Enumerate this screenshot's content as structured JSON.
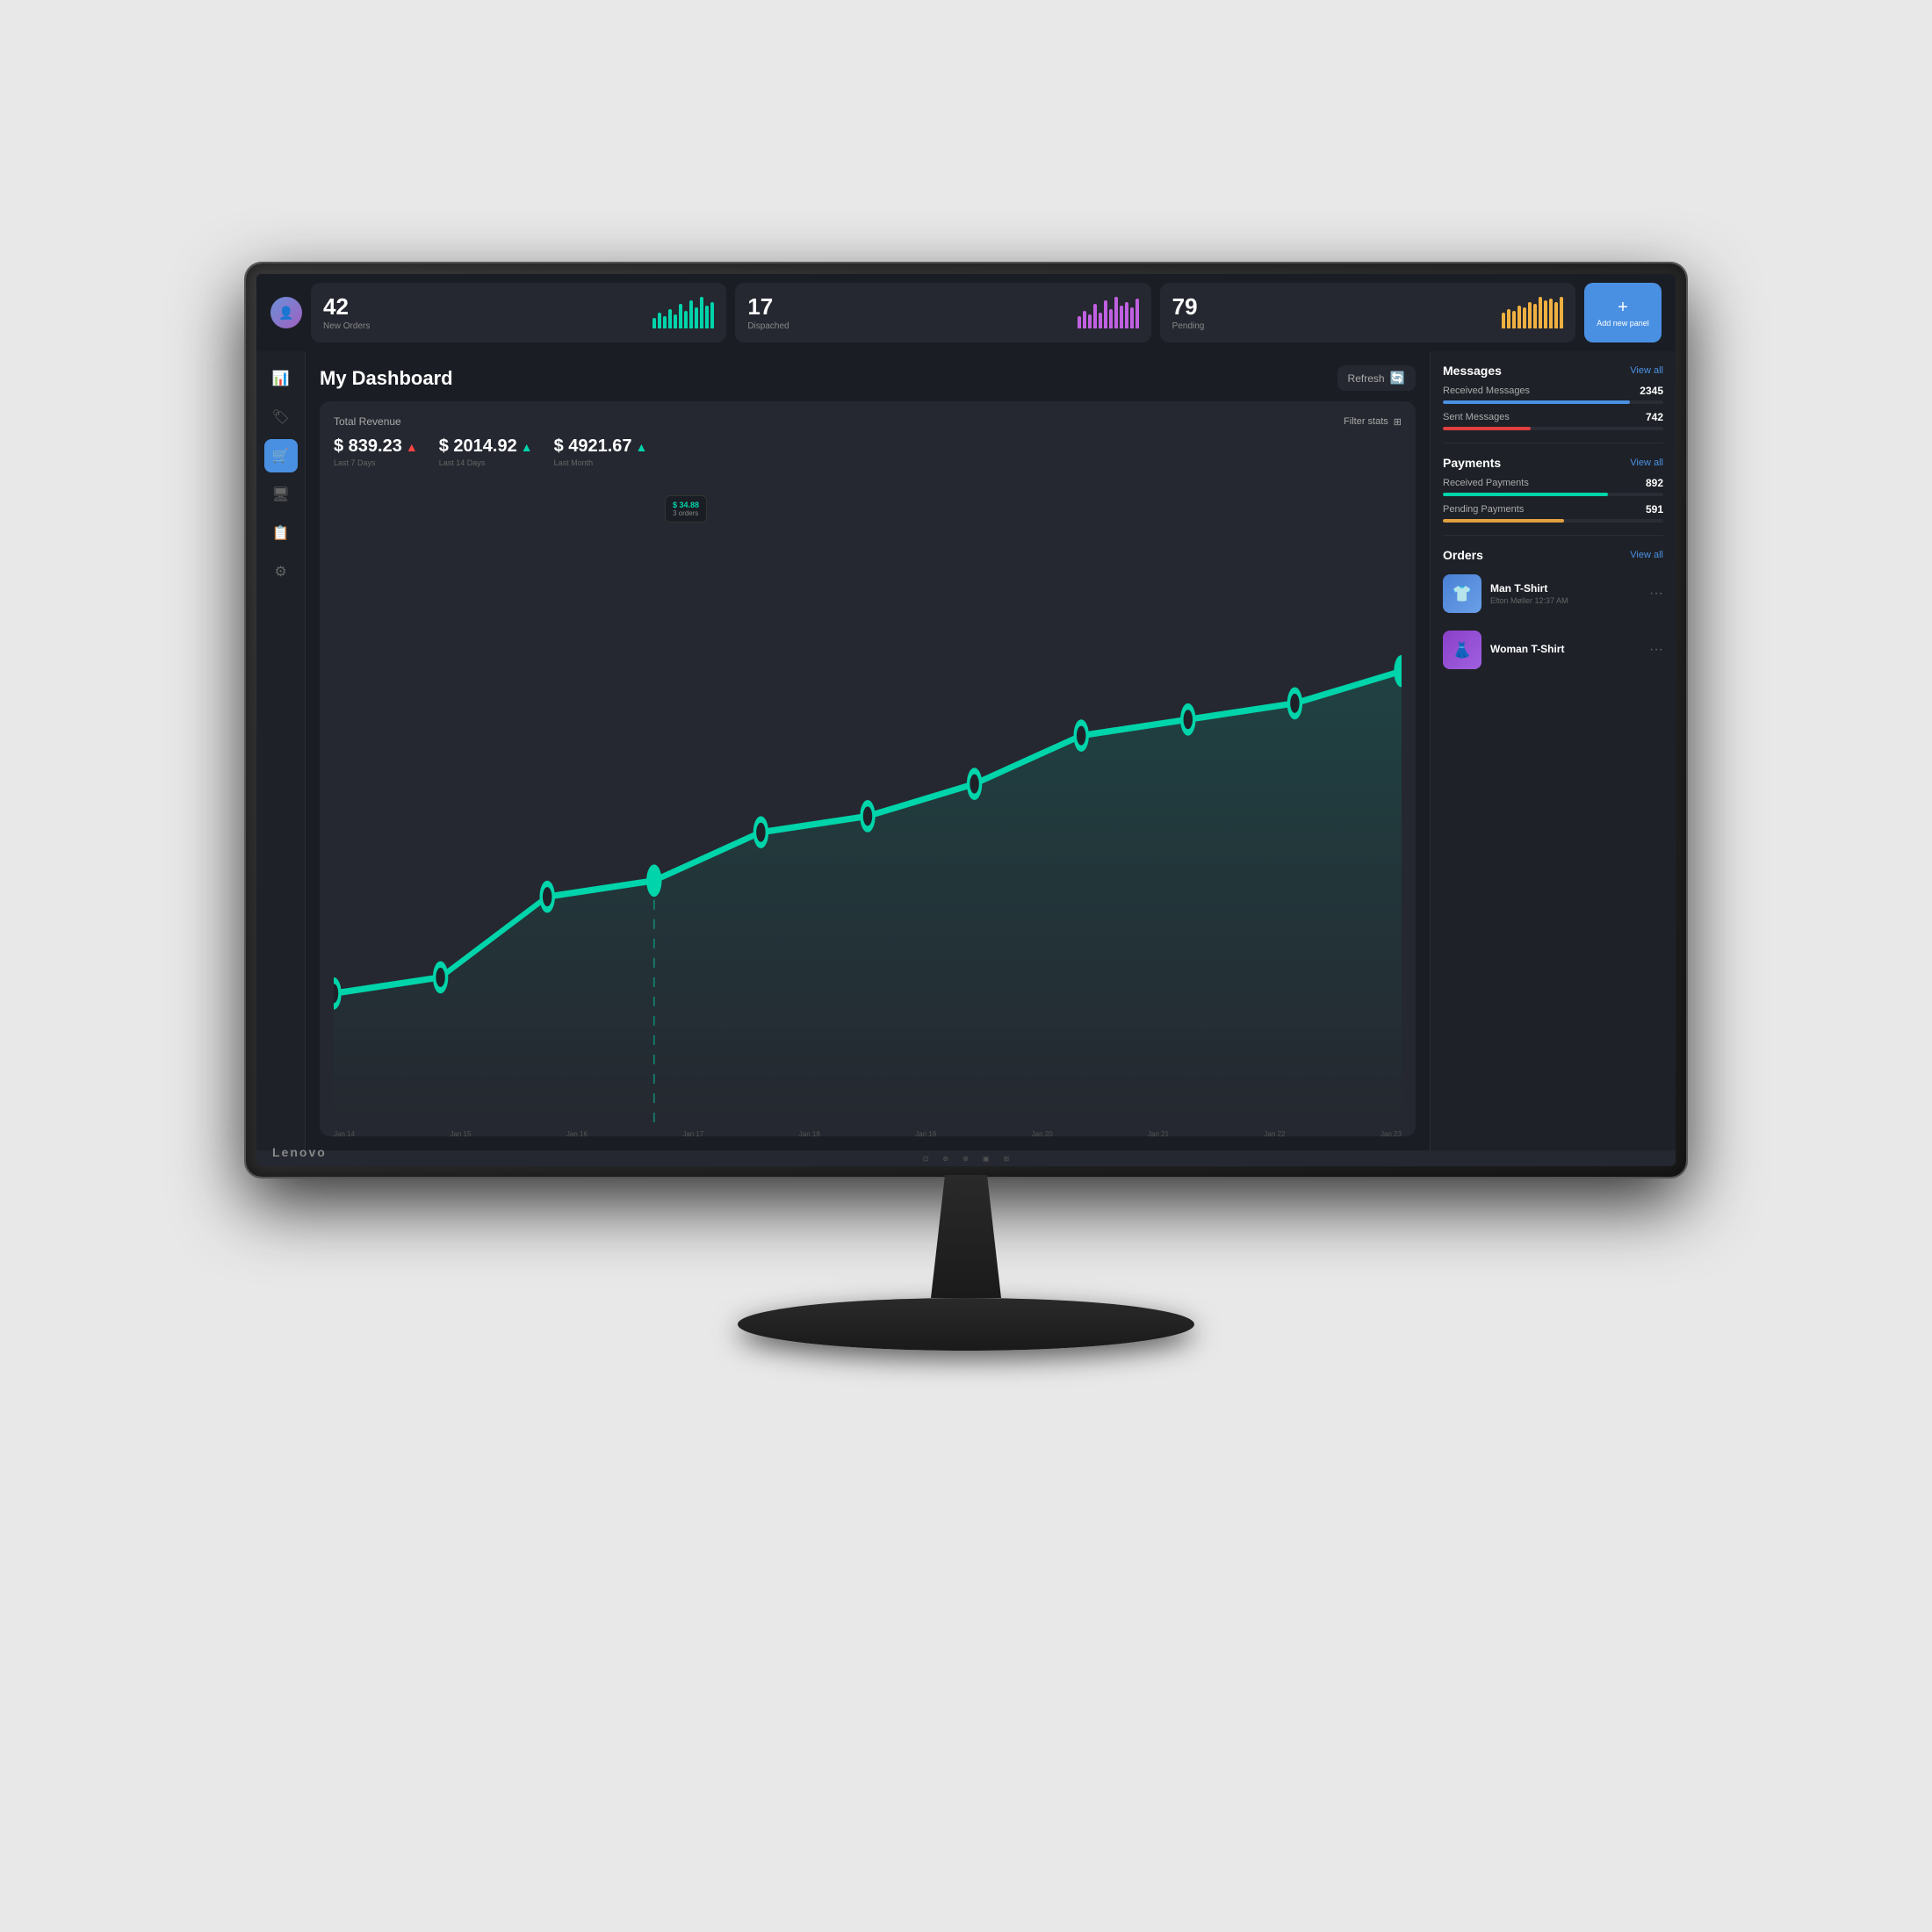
{
  "monitor": {
    "brand": "Lenovo"
  },
  "topbar": {
    "add_panel_label": "Add new panel",
    "stats": [
      {
        "id": "new-orders",
        "value": "42",
        "label": "New Orders",
        "chart_color": "#00d4aa",
        "bars": [
          3,
          5,
          4,
          6,
          5,
          7,
          8,
          6,
          9,
          7,
          10,
          8,
          11,
          9,
          12,
          10
        ]
      },
      {
        "id": "dispatched",
        "value": "17",
        "label": "Dispached",
        "chart_color": "#c060e0",
        "bars": [
          4,
          6,
          5,
          8,
          6,
          9,
          7,
          10,
          8,
          11,
          7,
          9,
          8,
          10,
          9,
          11
        ]
      },
      {
        "id": "pending",
        "value": "79",
        "label": "Pending",
        "chart_color": "#f0b040",
        "bars": [
          5,
          7,
          6,
          8,
          7,
          9,
          8,
          10,
          9,
          11,
          10,
          8,
          9,
          10,
          11,
          10
        ]
      }
    ]
  },
  "sidebar": {
    "items": [
      {
        "id": "chart",
        "icon": "📊",
        "active": false
      },
      {
        "id": "flag",
        "icon": "🏷",
        "active": false
      },
      {
        "id": "cart",
        "icon": "🛒",
        "active": true
      },
      {
        "id": "monitor",
        "icon": "🖥",
        "active": false
      },
      {
        "id": "docs",
        "icon": "📋",
        "active": false
      },
      {
        "id": "settings",
        "icon": "⚙",
        "active": false
      }
    ]
  },
  "dashboard": {
    "title": "My Dashboard",
    "refresh_label": "Refresh",
    "revenue": {
      "title": "Total Revenue",
      "filter_label": "Filter stats",
      "metrics": [
        {
          "id": "last7",
          "value": "$ 839.23",
          "label": "Last 7 Days",
          "indicator": "red"
        },
        {
          "id": "last14",
          "value": "$ 2014.92",
          "label": "Last 14 Days",
          "indicator": "green"
        },
        {
          "id": "lastmonth",
          "value": "$ 4921.67",
          "label": "Last Month",
          "indicator": "green"
        }
      ],
      "tooltip": {
        "value": "$ 34.88",
        "sub": "3 orders"
      },
      "x_labels": [
        "Jan 14",
        "Jan 15",
        "Jan 16",
        "Jan 17",
        "Jan 18",
        "Jan 19",
        "Jan 20",
        "Jan 21",
        "Jan 22",
        "Jan 23"
      ]
    }
  },
  "right_panel": {
    "messages": {
      "title": "Messages",
      "view_all": "View all",
      "items": [
        {
          "label": "Received Messages",
          "value": "2345",
          "bar_color": "#4a90e2",
          "bar_width": "85"
        },
        {
          "label": "Sent Messages",
          "value": "742",
          "bar_color": "#e04040",
          "bar_width": "40"
        }
      ]
    },
    "payments": {
      "title": "Payments",
      "view_all": "View all",
      "items": [
        {
          "label": "Received Payments",
          "value": "892",
          "bar_color": "#00d4aa",
          "bar_width": "75"
        },
        {
          "label": "Pending Payments",
          "value": "591",
          "bar_color": "#e0a040",
          "bar_width": "55"
        }
      ]
    },
    "orders": {
      "title": "Orders",
      "view_all": "View all",
      "items": [
        {
          "id": "man-tshirt",
          "name": "Man T-Shirt",
          "sub": "Elton Møller  12:37 AM",
          "thumb_type": "blue",
          "icon": "👕"
        },
        {
          "id": "woman-tshirt",
          "name": "Woman T-Shirt",
          "sub": "",
          "thumb_type": "purple",
          "icon": "👗"
        }
      ]
    }
  }
}
